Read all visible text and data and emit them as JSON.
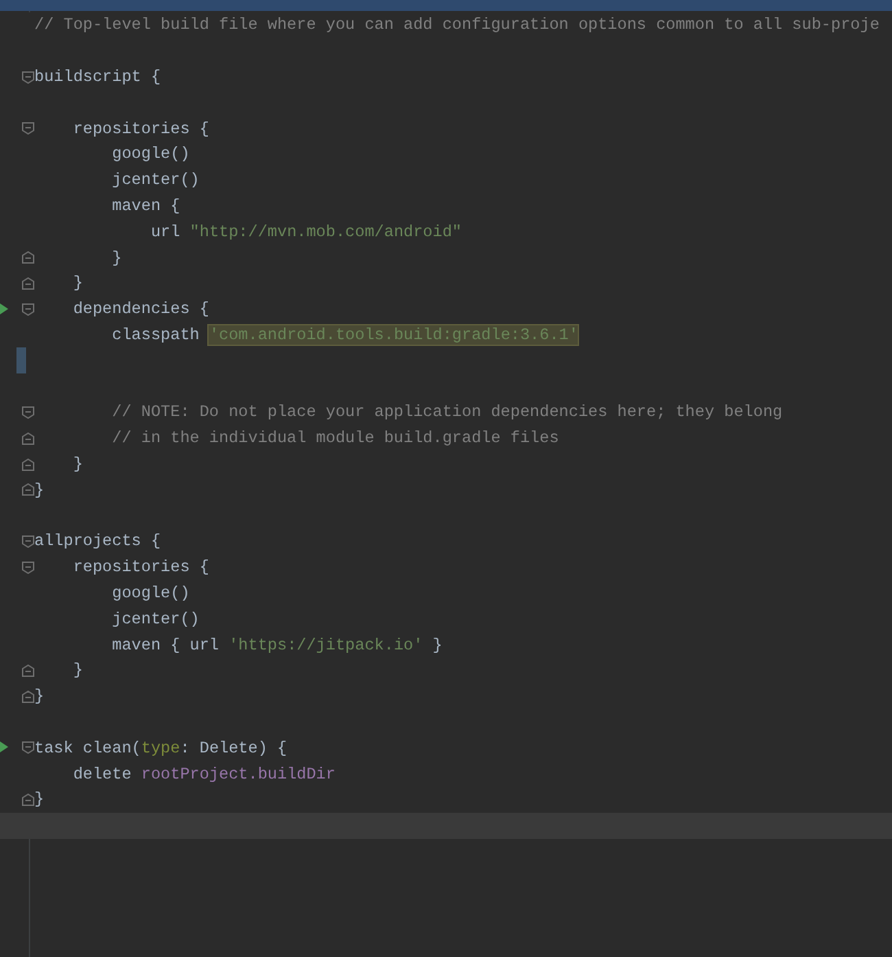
{
  "editor": {
    "lines": [
      {
        "fold_open": false,
        "fold_close": false,
        "run": false,
        "changed": false,
        "tokens": [
          {
            "text": "// Top-level build file where you can add configuration options common to all sub-proje",
            "kind": "comment"
          }
        ]
      },
      {
        "fold_open": false,
        "fold_close": false,
        "run": false,
        "changed": false
      },
      {
        "fold_open": true,
        "fold_close": false,
        "run": false,
        "changed": false,
        "tokens": [
          {
            "text": "buildscript {",
            "kind": "plain"
          }
        ]
      },
      {
        "fold_open": false,
        "fold_close": false,
        "run": false,
        "changed": false
      },
      {
        "fold_open": true,
        "fold_close": false,
        "run": false,
        "changed": false,
        "tokens": [
          {
            "text": "    repositories {",
            "kind": "plain"
          }
        ]
      },
      {
        "fold_open": false,
        "fold_close": false,
        "run": false,
        "changed": false,
        "tokens": [
          {
            "text": "        google()",
            "kind": "plain"
          }
        ]
      },
      {
        "fold_open": false,
        "fold_close": false,
        "run": false,
        "changed": false,
        "tokens": [
          {
            "text": "        jcenter()",
            "kind": "plain"
          }
        ]
      },
      {
        "fold_open": false,
        "fold_close": false,
        "run": false,
        "changed": false,
        "tokens": [
          {
            "text": "        maven {",
            "kind": "plain"
          }
        ]
      },
      {
        "fold_open": false,
        "fold_close": false,
        "run": false,
        "changed": false,
        "tokens": [
          {
            "text": "            url ",
            "kind": "plain"
          },
          {
            "text": "\"http://mvn.mob.com/android\"",
            "kind": "string",
            "highlighted": false
          }
        ]
      },
      {
        "fold_open": false,
        "fold_close": true,
        "run": false,
        "changed": false,
        "tokens": [
          {
            "text": "        }",
            "kind": "plain"
          }
        ]
      },
      {
        "fold_open": false,
        "fold_close": true,
        "run": false,
        "changed": false,
        "tokens": [
          {
            "text": "    }",
            "kind": "plain"
          }
        ]
      },
      {
        "fold_open": true,
        "fold_close": false,
        "run": true,
        "changed": false,
        "tokens": [
          {
            "text": "    dependencies {",
            "kind": "plain"
          }
        ]
      },
      {
        "fold_open": false,
        "fold_close": false,
        "run": false,
        "changed": false,
        "tokens": [
          {
            "text": "        classpath ",
            "kind": "plain"
          },
          {
            "text": "'com.android.tools.build:gradle:3.6.1'",
            "kind": "string",
            "highlighted": true
          }
        ]
      },
      {
        "fold_open": false,
        "fold_close": false,
        "run": false,
        "changed": true
      },
      {
        "fold_open": false,
        "fold_close": false,
        "run": false,
        "changed": false
      },
      {
        "fold_open": true,
        "fold_close": false,
        "run": false,
        "changed": false,
        "tokens": [
          {
            "text": "        // NOTE: Do not place your application dependencies here; they belong",
            "kind": "comment"
          }
        ]
      },
      {
        "fold_open": false,
        "fold_close": true,
        "run": false,
        "changed": false,
        "tokens": [
          {
            "text": "        // in the individual module build.gradle files",
            "kind": "comment"
          }
        ]
      },
      {
        "fold_open": false,
        "fold_close": true,
        "run": false,
        "changed": false,
        "tokens": [
          {
            "text": "    }",
            "kind": "plain"
          }
        ]
      },
      {
        "fold_open": false,
        "fold_close": true,
        "run": false,
        "changed": false,
        "tokens": [
          {
            "text": "}",
            "kind": "plain"
          }
        ]
      },
      {
        "fold_open": false,
        "fold_close": false,
        "run": false,
        "changed": false
      },
      {
        "fold_open": true,
        "fold_close": false,
        "run": false,
        "changed": false,
        "tokens": [
          {
            "text": "allprojects {",
            "kind": "plain"
          }
        ]
      },
      {
        "fold_open": true,
        "fold_close": false,
        "run": false,
        "changed": false,
        "tokens": [
          {
            "text": "    repositories {",
            "kind": "plain"
          }
        ]
      },
      {
        "fold_open": false,
        "fold_close": false,
        "run": false,
        "changed": false,
        "tokens": [
          {
            "text": "        google()",
            "kind": "plain"
          }
        ]
      },
      {
        "fold_open": false,
        "fold_close": false,
        "run": false,
        "changed": false,
        "tokens": [
          {
            "text": "        jcenter()",
            "kind": "plain"
          }
        ]
      },
      {
        "fold_open": false,
        "fold_close": false,
        "run": false,
        "changed": false,
        "tokens": [
          {
            "text": "        maven { url ",
            "kind": "plain"
          },
          {
            "text": "'https://jitpack.io'",
            "kind": "string",
            "highlighted": false
          },
          {
            "text": " }",
            "kind": "plain"
          }
        ]
      },
      {
        "fold_open": false,
        "fold_close": true,
        "run": false,
        "changed": false,
        "tokens": [
          {
            "text": "    }",
            "kind": "plain"
          }
        ]
      },
      {
        "fold_open": false,
        "fold_close": true,
        "run": false,
        "changed": false,
        "tokens": [
          {
            "text": "}",
            "kind": "plain"
          }
        ]
      },
      {
        "fold_open": false,
        "fold_close": false,
        "run": false,
        "changed": false
      },
      {
        "fold_open": true,
        "fold_close": false,
        "run": true,
        "changed": false,
        "tokens": [
          {
            "text": "task clean(",
            "kind": "plain"
          },
          {
            "text": "type",
            "kind": "param"
          },
          {
            "text": ": Delete) {",
            "kind": "plain"
          }
        ]
      },
      {
        "fold_open": false,
        "fold_close": false,
        "run": false,
        "changed": false,
        "tokens": [
          {
            "text": "    delete ",
            "kind": "plain"
          },
          {
            "text": "rootProject.buildDir",
            "kind": "property"
          }
        ]
      },
      {
        "fold_open": false,
        "fold_close": true,
        "run": false,
        "changed": false,
        "tokens": [
          {
            "text": "}",
            "kind": "plain"
          }
        ]
      },
      {
        "fold_open": false,
        "fold_close": false,
        "run": false,
        "changed": false,
        "current": true
      }
    ]
  }
}
